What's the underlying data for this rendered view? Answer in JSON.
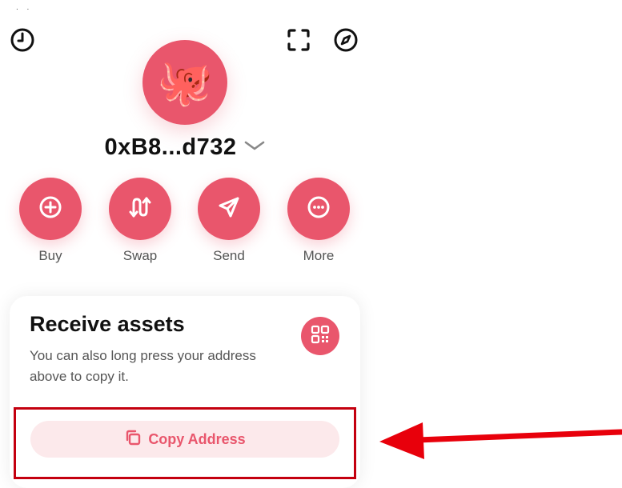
{
  "status_bar": {
    "dots": ". ."
  },
  "header": {
    "history_icon": "clock-icon",
    "scan_icon": "scan-frame-icon",
    "explore_icon": "compass-icon"
  },
  "wallet": {
    "avatar_emoji": "🐙",
    "address": "0xB8...d732",
    "accent_color": "#E9566C"
  },
  "actions": [
    {
      "label": "Buy",
      "icon": "plus-circle-icon"
    },
    {
      "label": "Swap",
      "icon": "swap-arrows-icon"
    },
    {
      "label": "Send",
      "icon": "send-icon"
    },
    {
      "label": "More",
      "icon": "more-dots-icon"
    }
  ],
  "receive_card": {
    "title": "Receive assets",
    "description": "You can also long press your address above to copy it.",
    "qr_icon": "qr-code-icon",
    "copy_button_label": "Copy Address",
    "copy_icon": "copy-icon"
  },
  "annotation": {
    "highlight_color": "#C4000F",
    "arrow_color": "#E8000B"
  }
}
